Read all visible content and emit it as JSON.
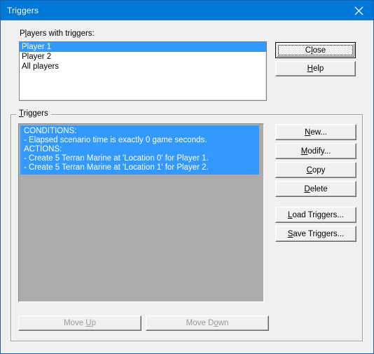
{
  "window": {
    "title": "Triggers",
    "close_icon": "close-icon",
    "accent_title_bar": "#0078d7",
    "dialog_background": "#f0f0f0"
  },
  "players_section": {
    "label_pre": "P",
    "label_accel": "l",
    "label_post": "ayers with triggers:",
    "label_full": "Players with triggers:",
    "items": [
      {
        "label": "Player 1",
        "selected": true
      },
      {
        "label": "Player 2",
        "selected": false
      },
      {
        "label": "All players",
        "selected": false
      }
    ],
    "selection_color": "#3399ff"
  },
  "top_buttons": [
    {
      "name": "close-button",
      "pre": "C",
      "accel": "l",
      "post": "ose",
      "full": "Close",
      "default": true,
      "disabled": false
    },
    {
      "name": "help-button",
      "pre": "",
      "accel": "H",
      "post": "elp",
      "full": "Help",
      "default": false,
      "disabled": false
    }
  ],
  "triggers_group": {
    "title_pre": "",
    "title_accel": "T",
    "title_post": "riggers",
    "title_full": "Triggers",
    "list_background": "#acacac",
    "entry_background": "#3399ff",
    "entry_lines": [
      "CONDITIONS:",
      "- Elapsed scenario time is exactly 0 game seconds.",
      "ACTIONS:",
      "- Create 5 Terran Marine at 'Location 0' for Player 1.",
      "- Create 5 Terran Marine at 'Location 1' for Player 2."
    ]
  },
  "side_buttons": [
    {
      "name": "new-button",
      "pre": "",
      "accel": "N",
      "post": "ew...",
      "full": "New...",
      "disabled": false
    },
    {
      "name": "modify-button",
      "pre": "",
      "accel": "M",
      "post": "odify...",
      "full": "Modify...",
      "disabled": false
    },
    {
      "name": "copy-button",
      "pre": "",
      "accel": "C",
      "post": "opy",
      "full": "Copy",
      "disabled": false
    },
    {
      "name": "delete-button",
      "pre": "",
      "accel": "D",
      "post": "elete",
      "full": "Delete",
      "disabled": false
    },
    {
      "name": "load-triggers-button",
      "pre": "",
      "accel": "L",
      "post": "oad Triggers...",
      "full": "Load Triggers...",
      "disabled": false
    },
    {
      "name": "save-triggers-button",
      "pre": "",
      "accel": "S",
      "post": "ave Triggers...",
      "full": "Save Triggers...",
      "disabled": false
    }
  ],
  "bottom_buttons": [
    {
      "name": "move-up-button",
      "pre": "Move ",
      "accel": "U",
      "post": "p",
      "full": "Move Up",
      "disabled": true
    },
    {
      "name": "move-down-button",
      "pre": "Move D",
      "accel": "o",
      "post": "wn",
      "full": "Move Down",
      "disabled": true
    }
  ]
}
